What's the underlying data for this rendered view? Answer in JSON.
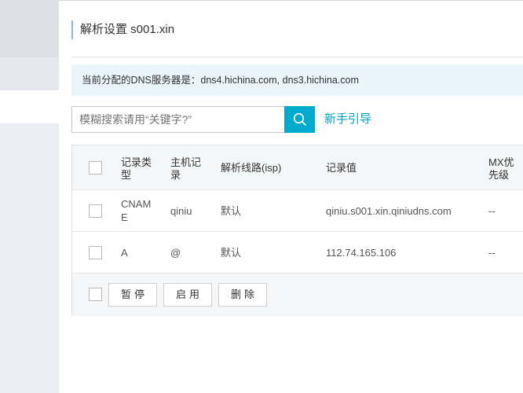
{
  "header": {
    "title": "解析设置 s001.xin"
  },
  "notice": {
    "text": "当前分配的DNS服务器是：dns4.hichina.com, dns3.hichina.com"
  },
  "search": {
    "placeholder": "模糊搜索请用“关键字?”",
    "guide_link": "新手引导",
    "button_icon": "search-icon"
  },
  "table": {
    "columns": [
      "记录类型",
      "主机记录",
      "解析线路(isp)",
      "记录值",
      "MX优先级"
    ],
    "rows": [
      {
        "type": "CNAME",
        "host": "qiniu",
        "line": "默认",
        "value": "qiniu.s001.xin.qiniudns.com",
        "mx": "--"
      },
      {
        "type": "A",
        "host": "@",
        "line": "默认",
        "value": "112.74.165.106",
        "mx": "--"
      }
    ]
  },
  "footer": {
    "pause": "暂停",
    "enable": "启用",
    "delete": "删除"
  },
  "colors": {
    "accent": "#00aaca",
    "link": "#00a2c4",
    "notice_bg": "#eaf4fb"
  }
}
